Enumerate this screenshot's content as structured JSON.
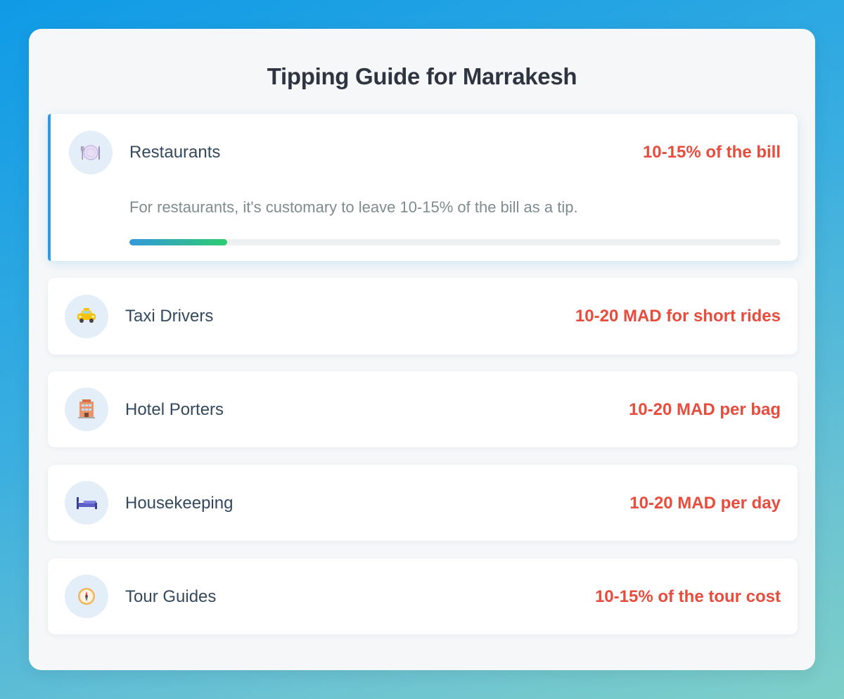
{
  "page": {
    "title": "Tipping Guide for Marrakesh"
  },
  "items": [
    {
      "name": "Restaurants",
      "value": "10-15% of the bill",
      "icon": "plate-utensils-icon",
      "expanded": true,
      "description": "For restaurants, it's customary to leave 10-15% of the bill as a tip.",
      "progress_percent": 15
    },
    {
      "name": "Taxi Drivers",
      "value": "10-20 MAD for short rides",
      "icon": "taxi-icon",
      "expanded": false
    },
    {
      "name": "Hotel Porters",
      "value": "10-20 MAD per bag",
      "icon": "hotel-icon",
      "expanded": false
    },
    {
      "name": "Housekeeping",
      "value": "10-20 MAD per day",
      "icon": "bed-icon",
      "expanded": false
    },
    {
      "name": "Tour Guides",
      "value": "10-15% of the tour cost",
      "icon": "compass-icon",
      "expanded": false
    }
  ],
  "colors": {
    "accent": "#3498db",
    "value": "#e74c3c",
    "progress_start": "#3498db",
    "progress_end": "#2ecc71"
  }
}
